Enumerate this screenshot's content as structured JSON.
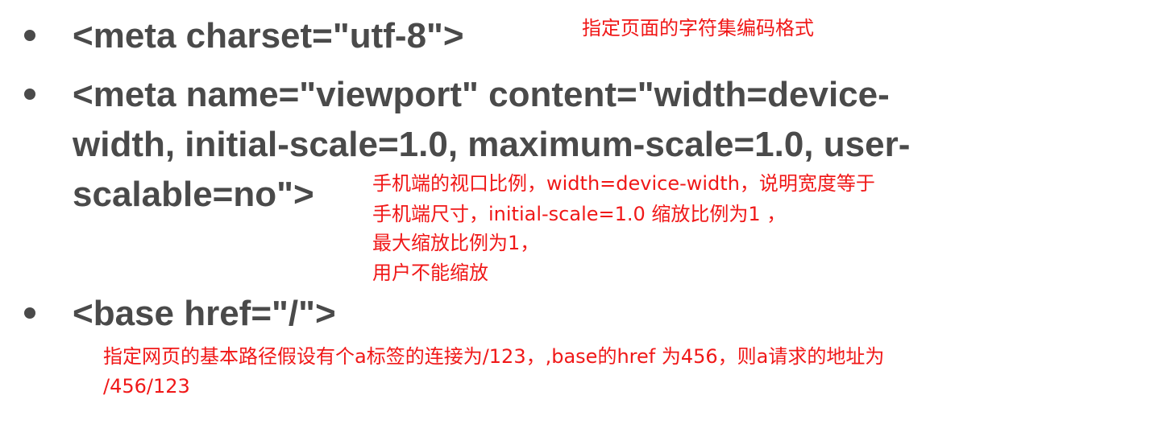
{
  "items": [
    {
      "code_lines": [
        "<meta charset=\"utf-8\">"
      ],
      "note_lines": [
        "指定页面的字符集编码格式"
      ]
    },
    {
      "code_lines": [
        "<meta name=\"viewport\" content=\"width=device-",
        "width, initial-scale=1.0, maximum-scale=1.0, user-",
        "scalable=no\">"
      ],
      "note_lines": [
        "手机端的视口比例，width=device-width，说明宽度等于",
        "手机端尺寸，initial-scale=1.0 缩放比例为1 ，",
        "最大缩放比例为1，",
        "用户不能缩放"
      ]
    },
    {
      "code_lines": [
        "<base href=\"/\">"
      ],
      "note_lines": [
        "指定网页的基本路径假设有个a标签的连接为/123，,base的href 为456，则a请求的地址为",
        "/456/123"
      ]
    }
  ],
  "colors": {
    "code": "#4a4a4a",
    "note": "#f01818",
    "background": "#ffffff"
  }
}
